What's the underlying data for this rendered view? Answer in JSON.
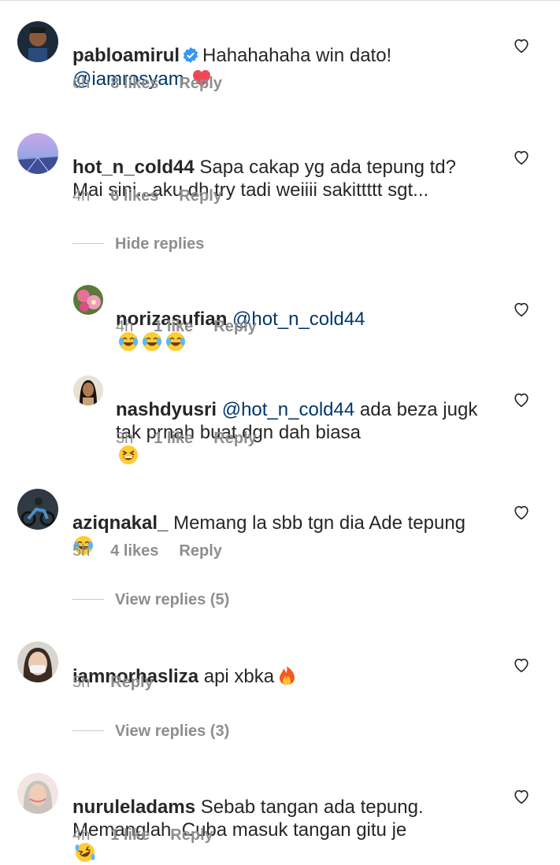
{
  "comments": [
    {
      "username": "pabloamirul",
      "verified": true,
      "text": "Hahahahaha win dato!\n@iamrosyam",
      "time": "6h",
      "likes": "8 likes",
      "reply": "Reply"
    },
    {
      "username": "hot_n_cold44",
      "text": "Sapa cakap yg ada tepung td?\nMai sini...aku dh try tadi weiiii sakittttt sgt...",
      "time": "4h",
      "likes": "6 likes",
      "reply": "Reply",
      "thread_label": "Hide replies",
      "replies": [
        {
          "username": "norizasufian",
          "text": "@hot_n_cold44",
          "time": "4h",
          "likes": "1 like",
          "reply": "Reply"
        },
        {
          "username": "nashdyusri",
          "text": "@hot_n_cold44 ada beza jugk\ntak prnah buat dgn dah biasa",
          "time": "3h",
          "likes": "1 like",
          "reply": "Reply"
        }
      ]
    },
    {
      "username": "aziqnakal_",
      "text": "Memang la sbb tgn dia Ade tepung",
      "time": "5h",
      "likes": "4 likes",
      "reply": "Reply",
      "thread_label": "View replies (5)"
    },
    {
      "username": "iamnorhasliza",
      "text": "api xbka",
      "time": "5h",
      "reply": "Reply",
      "thread_label": "View replies (3)"
    },
    {
      "username": "nuruleladams",
      "text": "Sebab tangan ada tepung.\nMemanglah. Cuba masuk tangan gitu je",
      "time": "4h",
      "likes": "1 like",
      "reply": "Reply"
    }
  ],
  "icons": {
    "heart": "heart-outline-icon",
    "verified": "verified-badge-icon"
  },
  "colors": {
    "text": "#262626",
    "muted": "#8e8e8e",
    "mention": "#00376b",
    "verified": "#3897f0",
    "heart_emoji": "#ed4956"
  }
}
